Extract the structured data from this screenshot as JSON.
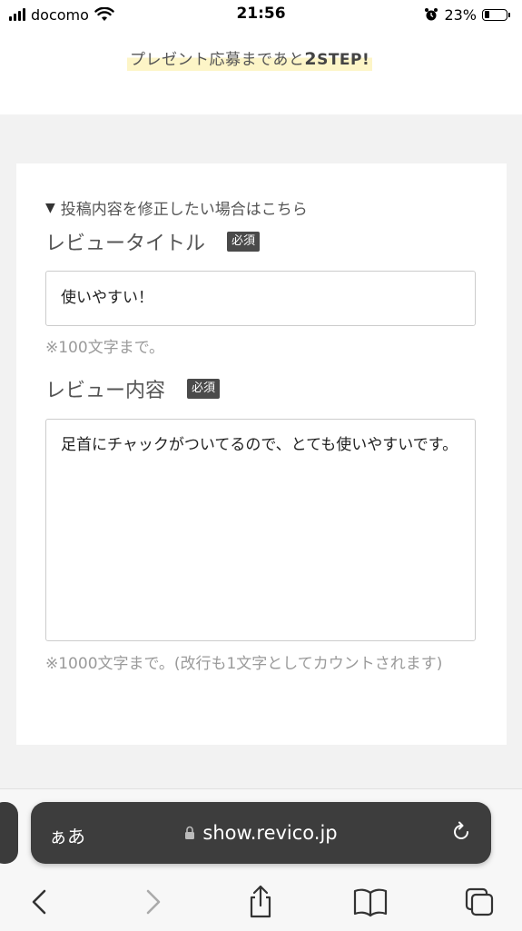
{
  "status_bar": {
    "carrier": "docomo",
    "time": "21:56",
    "battery_percent": "23%",
    "battery_level": 0.23
  },
  "banner": {
    "prefix": "プレゼント応募まであと",
    "count": "2",
    "suffix": "STEP!"
  },
  "form": {
    "edit_toggle": "投稿内容を修正したい場合はこちら",
    "title_field": {
      "label": "レビュータイトル",
      "required_badge": "必須",
      "value": "使いやすい！",
      "hint": "※100文字まで。"
    },
    "content_field": {
      "label": "レビュー内容",
      "required_badge": "必須",
      "value": "足首にチャックがついてるので、とても使いやすいです。",
      "hint": "※1000文字まで。(改行も1文字としてカウントされます)"
    }
  },
  "browser": {
    "text_size_label": "ぁあ",
    "url": "show.revico.jp"
  }
}
